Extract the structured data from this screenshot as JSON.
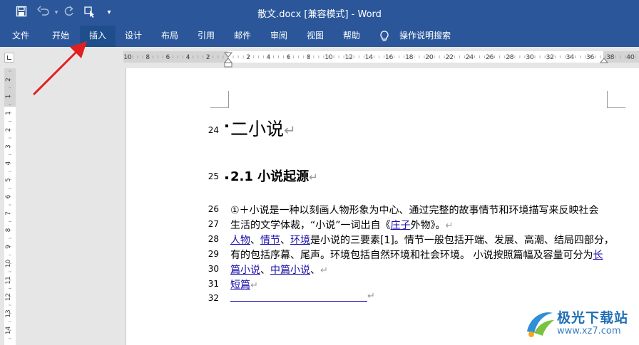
{
  "window": {
    "title": "散文.docx [兼容模式]  -  Word"
  },
  "quick_access": {
    "icons": [
      "save-icon",
      "undo-icon",
      "redo-icon",
      "touch-mode-icon",
      "customize-dropdown-icon"
    ]
  },
  "ribbon": {
    "tabs": [
      {
        "label": "文件"
      },
      {
        "label": "开始"
      },
      {
        "label": "插入"
      },
      {
        "label": "设计"
      },
      {
        "label": "布局"
      },
      {
        "label": "引用"
      },
      {
        "label": "邮件"
      },
      {
        "label": "审阅"
      },
      {
        "label": "视图"
      },
      {
        "label": "帮助"
      }
    ],
    "active_tab": "插入",
    "tell_me": "操作说明搜索"
  },
  "ruler": {
    "h_ticks": [
      "10",
      "8",
      "6",
      "4",
      "2",
      "2",
      "4",
      "6",
      "8",
      "10",
      "12",
      "14",
      "16",
      "18",
      "20",
      "22",
      "24",
      "26",
      "28",
      "30",
      "32",
      "34",
      "36",
      "38",
      "40"
    ],
    "v_ticks": [
      "2",
      "1",
      "1",
      "2",
      "3",
      "4",
      "5",
      "6",
      "7",
      "8",
      "9",
      "10",
      "11",
      "12",
      "13",
      "14"
    ]
  },
  "document": {
    "lines": [
      {
        "num": "24",
        "text": "二小说"
      },
      {
        "num": "25",
        "text": "2.1 小说起源"
      },
      {
        "num": "26",
        "text": "①＋小说是一种以刻画人物形象为中心、通过完整的故事情节和环境描写来反映社会"
      },
      {
        "num": "27",
        "pre": "生活的文学体裁，“小说”一词出自《",
        "link": "庄子",
        "post": "外物》。"
      },
      {
        "num": "28",
        "link1": "人物",
        "sep1": "、",
        "link2": "情节",
        "sep2": "、",
        "link3": "环境",
        "post": "是小说的三要素[1]。情节一般包括开端、发展、高潮、结局四部分，"
      },
      {
        "num": "29",
        "pre": "有的包括序幕、尾声。环境包括自然环境和社会环境。 小说按照篇幅及容量可分为",
        "link": "长"
      },
      {
        "num": "30",
        "link1": "篇小说",
        "sep1": "、",
        "link2": "中篇小说",
        "post": "、"
      },
      {
        "num": "31",
        "link": "短篇"
      },
      {
        "num": "32",
        "text": ""
      }
    ]
  },
  "watermark": {
    "brand": "极光下载站",
    "url": "www.xz7.com"
  }
}
